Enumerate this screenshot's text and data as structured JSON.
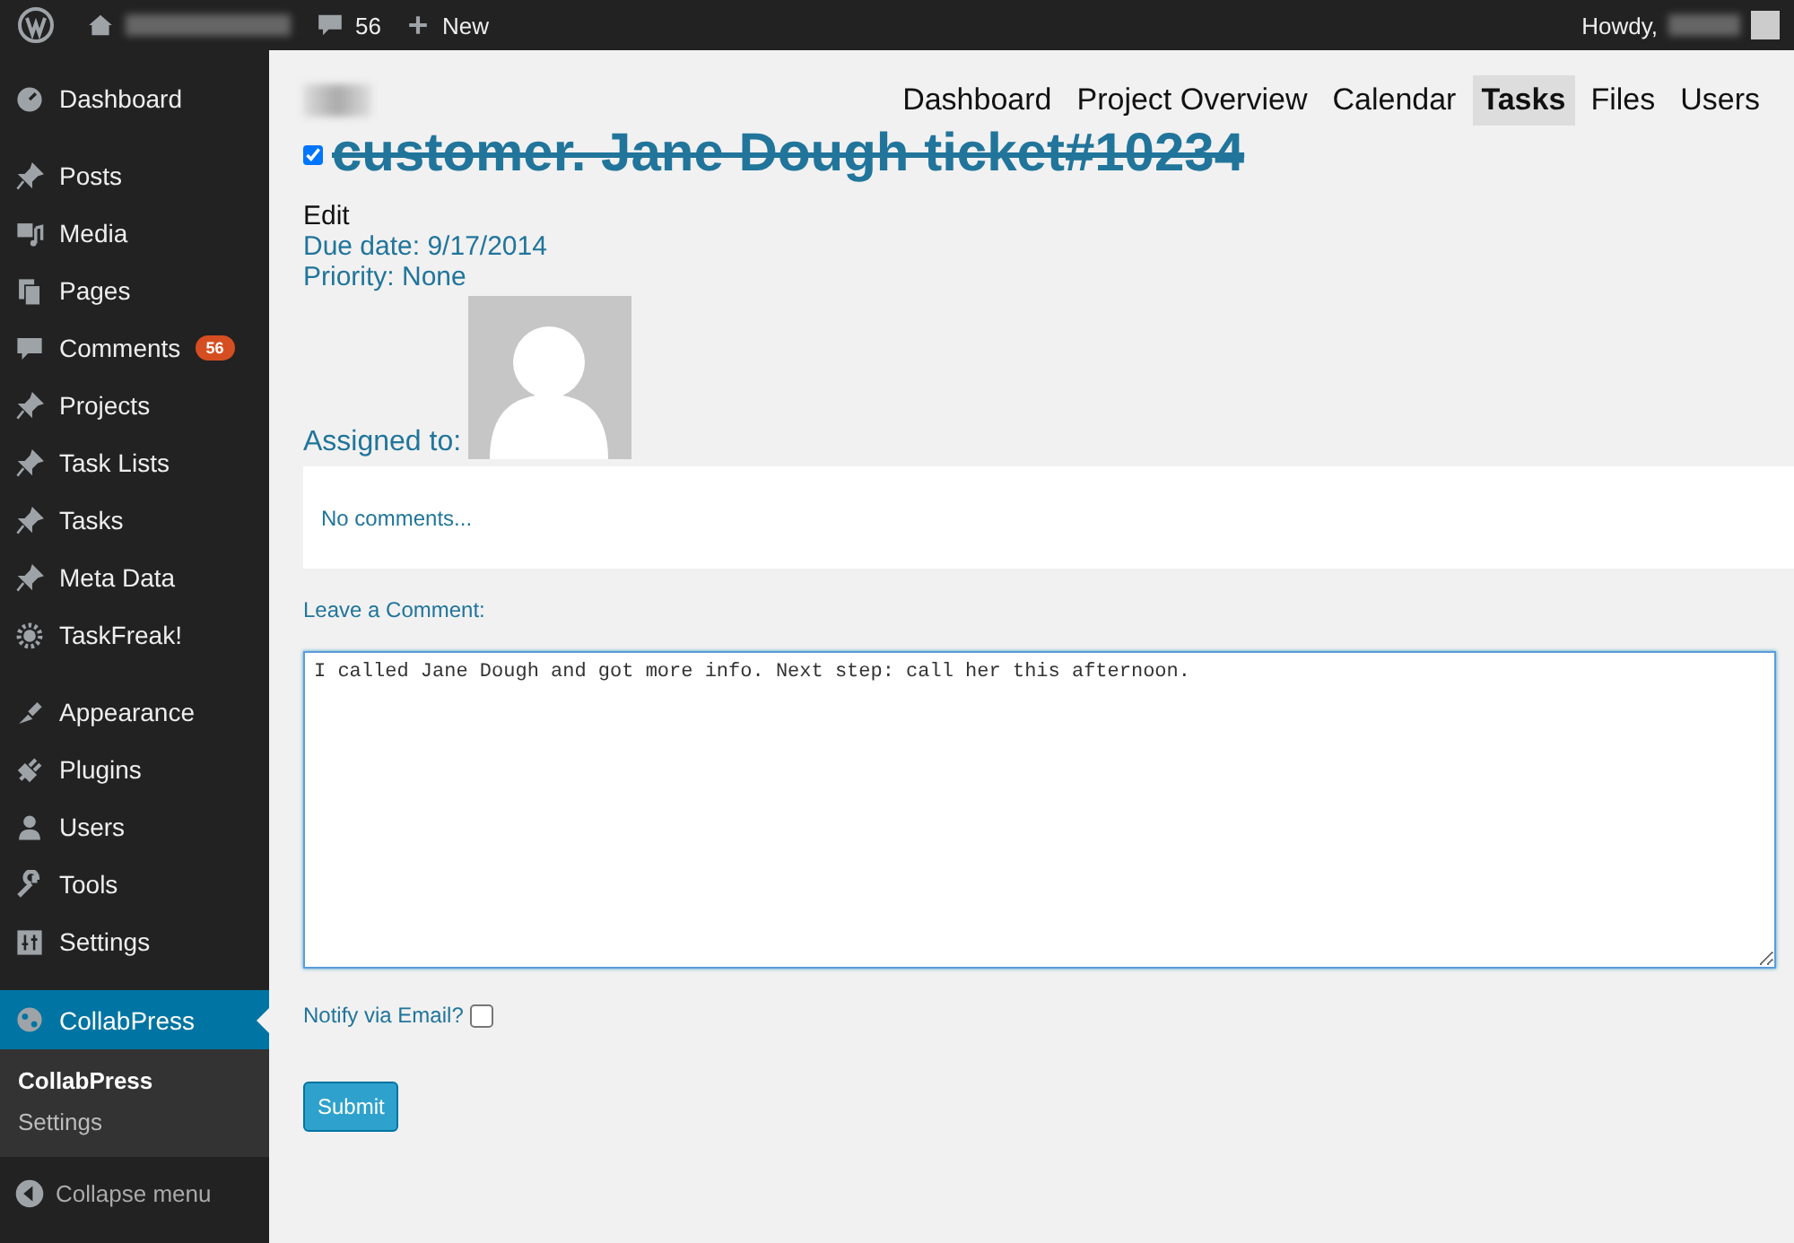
{
  "admin_bar": {
    "comments_count": "56",
    "new_label": "New",
    "greeting": "Howdy,"
  },
  "sidebar": {
    "groups": [
      {
        "items": [
          {
            "label": "Dashboard",
            "selected": false
          }
        ]
      },
      {
        "items": [
          {
            "label": "Posts",
            "selected": false
          },
          {
            "label": "Media",
            "selected": false
          },
          {
            "label": "Pages",
            "selected": false
          },
          {
            "label": "Comments",
            "selected": false,
            "badge": "56"
          },
          {
            "label": "Projects",
            "selected": false
          },
          {
            "label": "Task Lists",
            "selected": false
          },
          {
            "label": "Tasks",
            "selected": false
          },
          {
            "label": "Meta Data",
            "selected": false
          },
          {
            "label": "TaskFreak!",
            "selected": false
          }
        ]
      },
      {
        "items": [
          {
            "label": "Appearance",
            "selected": false
          },
          {
            "label": "Plugins",
            "selected": false
          },
          {
            "label": "Users",
            "selected": false
          },
          {
            "label": "Tools",
            "selected": false
          },
          {
            "label": "Settings",
            "selected": false
          }
        ]
      },
      {
        "items": [
          {
            "label": "CollabPress",
            "selected": true
          }
        ]
      }
    ],
    "submenu": [
      {
        "label": "CollabPress",
        "selected": true
      },
      {
        "label": "Settings",
        "selected": false
      }
    ],
    "collapse_label": "Collapse menu"
  },
  "nav_tabs": [
    {
      "label": "Dashboard",
      "selected": false
    },
    {
      "label": "Project Overview",
      "selected": false
    },
    {
      "label": "Calendar",
      "selected": false
    },
    {
      "label": "Tasks",
      "selected": true
    },
    {
      "label": "Files",
      "selected": false
    },
    {
      "label": "Users",
      "selected": false
    }
  ],
  "task": {
    "done": true,
    "title": "customer. Jane Dough ticket#10234",
    "edit_label": "Edit",
    "due_date": "Due date: 9/17/2014",
    "priority": "Priority: None",
    "assigned_label": "Assigned to:"
  },
  "comments": {
    "empty_text": "No comments...",
    "leave_label": "Leave a Comment:",
    "value": "I called Jane Dough and got more info. Next step: call her this afternoon.",
    "notify_label": "Notify via Email?",
    "notify": false,
    "submit": "Submit"
  }
}
